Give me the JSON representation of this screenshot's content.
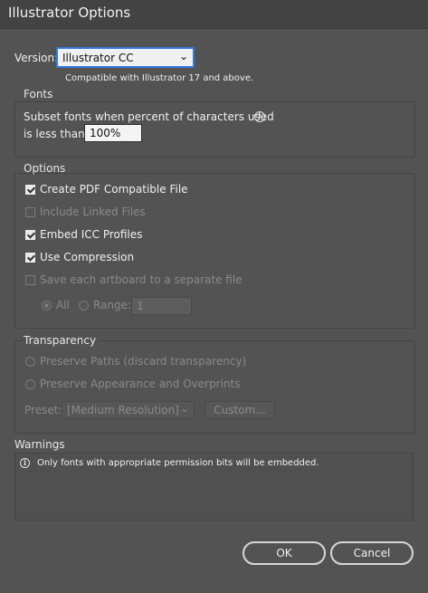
{
  "window": {
    "title": "Illustrator Options"
  },
  "version": {
    "label": "Version:",
    "selected": "Illustrator CC",
    "note": "Compatible with Illustrator 17 and above."
  },
  "fonts": {
    "group_label": "Fonts",
    "subset_line1": "Subset fonts when percent of characters used",
    "subset_line2": "is less than:",
    "percent_value": "100%"
  },
  "options": {
    "group_label": "Options",
    "create_pdf": {
      "label": "Create PDF Compatible File",
      "checked": true
    },
    "include_linked": {
      "label": "Include Linked Files",
      "checked": false,
      "enabled": false
    },
    "embed_icc": {
      "label": "Embed ICC Profiles",
      "checked": true
    },
    "use_compression": {
      "label": "Use Compression",
      "checked": true
    },
    "save_artboards": {
      "label": "Save each artboard to a separate file",
      "checked": false,
      "enabled": false
    },
    "all_label": "All",
    "range_label": "Range:",
    "range_value": "1"
  },
  "transparency": {
    "group_label": "Transparency",
    "preserve_paths": "Preserve Paths (discard transparency)",
    "preserve_appearance": "Preserve Appearance and Overprints",
    "preset_label": "Preset:",
    "preset_value": "[Medium Resolution]",
    "custom_label": "Custom..."
  },
  "warnings": {
    "group_label": "Warnings",
    "message": "Only fonts with appropriate permission bits will be embedded."
  },
  "buttons": {
    "ok": "OK",
    "cancel": "Cancel"
  },
  "colors": {
    "background": "#535353",
    "titlebar": "#434343",
    "focus": "#2f7be0"
  }
}
